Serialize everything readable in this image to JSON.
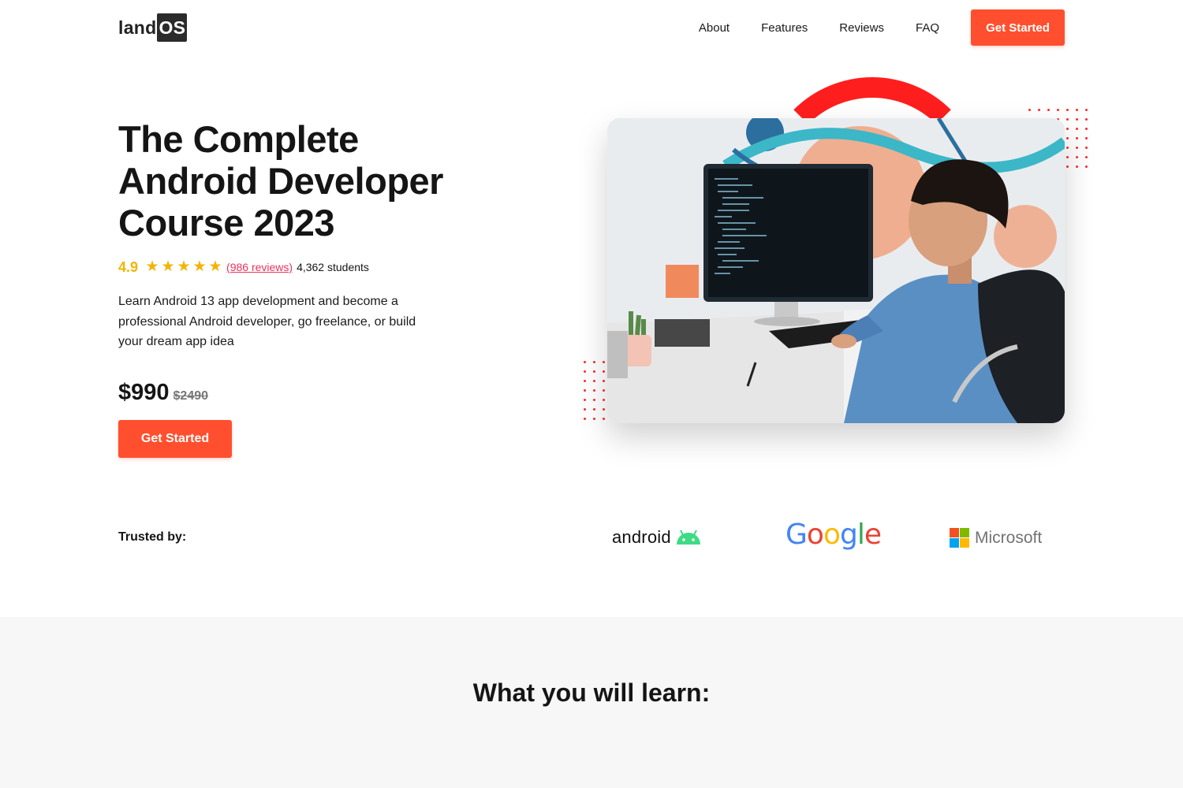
{
  "header": {
    "logo_land": "land",
    "logo_os": "OS",
    "nav": [
      "About",
      "Features",
      "Reviews",
      "FAQ"
    ],
    "cta": "Get Started"
  },
  "hero": {
    "title": "The Complete Android Developer Course 2023",
    "rating": "4.9",
    "stars": 5,
    "reviews": "(986 reviews)",
    "students": "4,362 students",
    "description": "Learn Android 13 app development and become a professional Android developer, go freelance, or build your dream app idea",
    "price": "$990",
    "old_price": "$2490",
    "cta": "Get Started"
  },
  "trusted": {
    "label": "Trusted by:",
    "brands": [
      "android",
      "Google",
      "Microsoft"
    ]
  },
  "learn": {
    "title": "What you will learn:"
  },
  "colors": {
    "accent": "#ff4f2e",
    "star": "#f4b400",
    "link": "#e8345f",
    "arc": "#ff1e1e"
  }
}
